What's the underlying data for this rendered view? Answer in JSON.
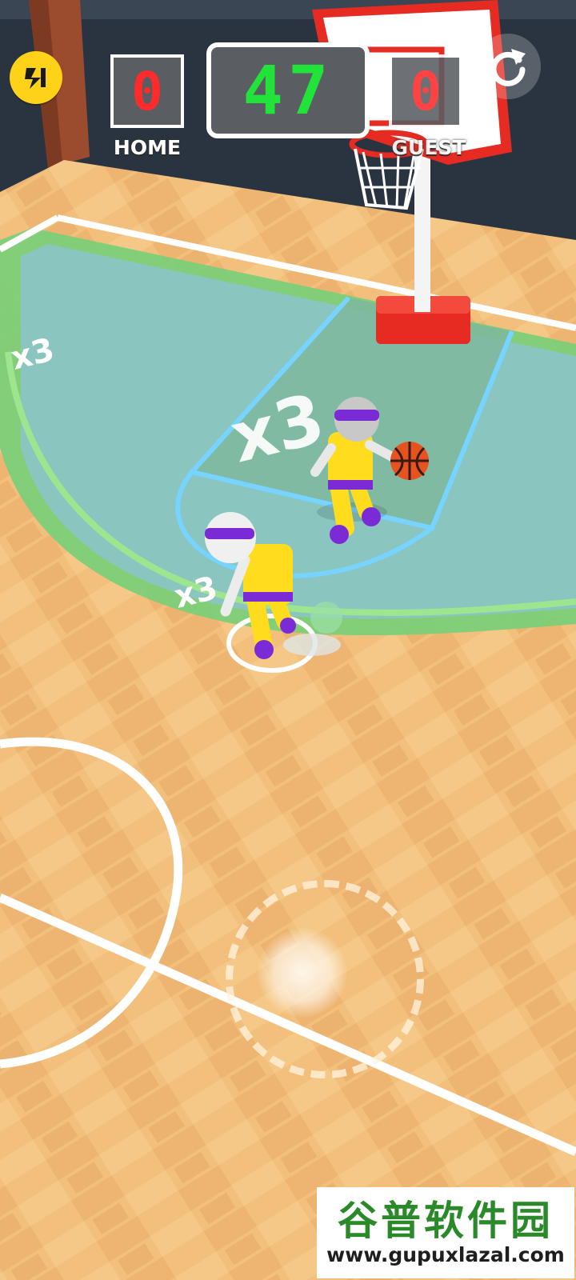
{
  "scoreboard": {
    "home_score": "0",
    "home_label": "HOME",
    "timer": "47",
    "guest_score": "0",
    "guest_label": "GUEST"
  },
  "court": {
    "multiplier_left": "x3",
    "multiplier_center": "x3",
    "multiplier_player": "x3"
  },
  "icons": {
    "top_left": "boost-icon",
    "top_right": "restart-icon"
  },
  "colors": {
    "hud_button": "#ffd21a",
    "score_digits": "#ff2a2a",
    "timer_digits": "#22e33a",
    "team_jersey": "#ffdc1e",
    "team_trim": "#7b2bd6",
    "three_point_zone": "#7ccf78",
    "paint_area": "#8ac6bf",
    "hoop_red": "#e52b22"
  },
  "watermark": {
    "title": "谷普软件园",
    "url": "www.gupuxlazal.com"
  }
}
